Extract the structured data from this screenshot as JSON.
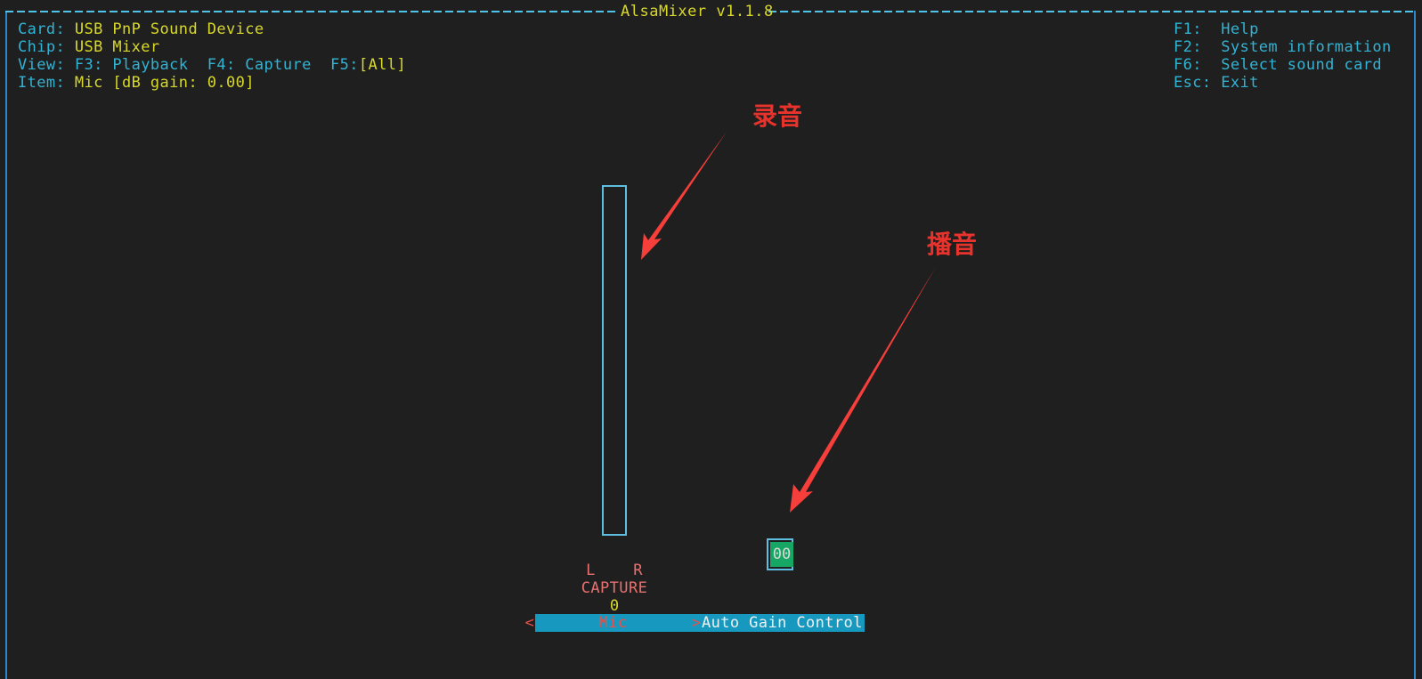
{
  "window": {
    "title": "AlsaMixer v1.1.8"
  },
  "header": {
    "card_label": "Card:",
    "card_value": "USB PnP Sound Device",
    "chip_label": "Chip:",
    "chip_value": "USB Mixer",
    "view_label": "View:",
    "view_f3": "F3: Playback",
    "view_f4": "F4: Capture",
    "view_f5_prefix": "F5:",
    "view_f5_value": "[All]",
    "item_label": "Item:",
    "item_value": "Mic [dB gain: 0.00]"
  },
  "keys": [
    {
      "key": "F1:",
      "action": "Help"
    },
    {
      "key": "F2:",
      "action": "System information"
    },
    {
      "key": "F6:",
      "action": "Select sound card"
    },
    {
      "key": "Esc:",
      "action": "Exit"
    }
  ],
  "mixer": {
    "capture_channel_labels": "L    R",
    "capture_label": "CAPTURE",
    "capture_value": "0",
    "capture_bar_fill_percent": 0,
    "playback_value": "00",
    "selected_control": "Mic",
    "next_control": "Auto Gain Control",
    "left_arrow": "<",
    "right_arrow": ">"
  },
  "annotations": [
    {
      "text": "录音"
    },
    {
      "text": "播音"
    }
  ],
  "colors": {
    "background": "#1f1f1f",
    "frame": "#4fc3e8",
    "title": "#d8d82a",
    "label": "#31b3d4",
    "value": "#d8d82a",
    "channel_label": "#e8706e",
    "selection_bg": "#1799bf",
    "playback_fill": "#16a765",
    "annotation": "#e8322c"
  }
}
